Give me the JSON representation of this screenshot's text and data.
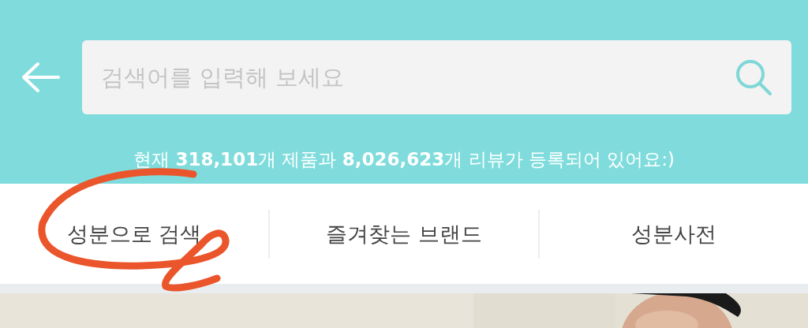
{
  "search": {
    "placeholder": "검색어를 입력해 보세요"
  },
  "stats": "현재 **318,101**개 제품과 **8,026,623**개 리뷰가 등록되어 있어요:)",
  "tabs": [
    {
      "label": "성분으로 검색",
      "circled": true
    },
    {
      "label": "즐겨찾는 브랜드",
      "circled": false
    },
    {
      "label": "성분사전",
      "circled": false
    }
  ]
}
